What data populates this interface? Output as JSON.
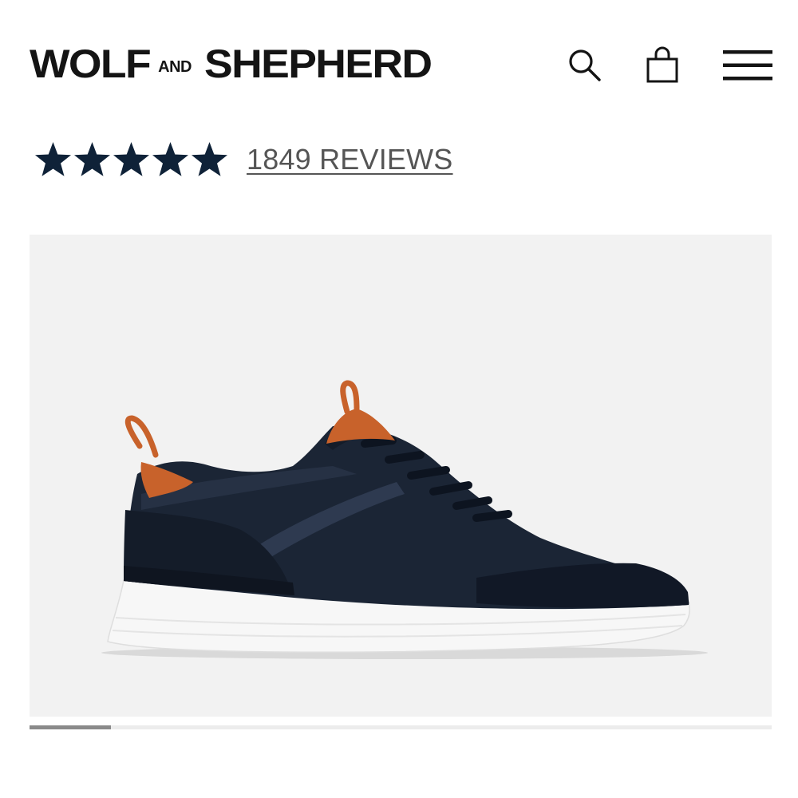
{
  "header": {
    "brand_word1": "WOLF",
    "brand_and": "AND",
    "brand_word2": "SHEPHERD",
    "icons": [
      "search-icon",
      "shopping-bag-icon",
      "hamburger-menu-icon"
    ]
  },
  "rating": {
    "stars": 5,
    "reviews_label": "1849 REVIEWS"
  },
  "gallery": {
    "current_index": 1,
    "progress_fraction": 0.11
  },
  "colors": {
    "brand_navy": "#0f2238",
    "shoe_navy": "#1b2535",
    "leather_orange": "#c8622b",
    "sole_white": "#f7f7f7",
    "gallery_bg": "#f2f2f2"
  }
}
